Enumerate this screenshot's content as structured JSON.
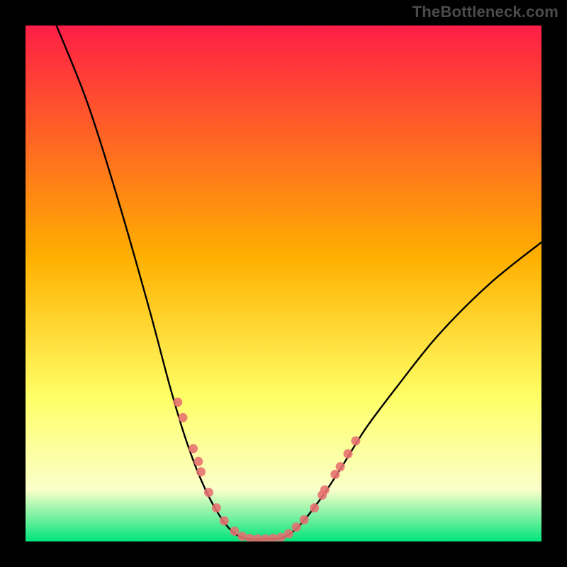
{
  "watermark": "TheBottleneck.com",
  "chart_data": {
    "type": "line",
    "title": "",
    "xlabel": "",
    "ylabel": "",
    "xlim": [
      0,
      100
    ],
    "ylim": [
      0,
      100
    ],
    "grid": false,
    "legend": false,
    "background_gradient": {
      "top": "#ff1e46",
      "mid1": "#ffb000",
      "mid2": "#ffff66",
      "mid3": "#faffca",
      "bottom": "#00e47a"
    },
    "curve": [
      {
        "x": 6,
        "y": 100
      },
      {
        "x": 12,
        "y": 85
      },
      {
        "x": 18,
        "y": 66
      },
      {
        "x": 24,
        "y": 45
      },
      {
        "x": 28,
        "y": 30
      },
      {
        "x": 31,
        "y": 20
      },
      {
        "x": 34,
        "y": 12
      },
      {
        "x": 37,
        "y": 6
      },
      {
        "x": 40,
        "y": 2
      },
      {
        "x": 43,
        "y": 0.5
      },
      {
        "x": 47,
        "y": 0.5
      },
      {
        "x": 50,
        "y": 0.8
      },
      {
        "x": 53,
        "y": 3
      },
      {
        "x": 57,
        "y": 8
      },
      {
        "x": 61,
        "y": 14
      },
      {
        "x": 66,
        "y": 22
      },
      {
        "x": 72,
        "y": 30
      },
      {
        "x": 80,
        "y": 40
      },
      {
        "x": 90,
        "y": 50
      },
      {
        "x": 100,
        "y": 58
      }
    ],
    "markers": [
      {
        "x": 29.5,
        "y": 27
      },
      {
        "x": 30.5,
        "y": 24
      },
      {
        "x": 32.5,
        "y": 18
      },
      {
        "x": 33.5,
        "y": 15.5
      },
      {
        "x": 34,
        "y": 13.5
      },
      {
        "x": 35.5,
        "y": 9.5
      },
      {
        "x": 37,
        "y": 6.5
      },
      {
        "x": 38.5,
        "y": 4
      },
      {
        "x": 40.5,
        "y": 2
      },
      {
        "x": 42,
        "y": 1
      },
      {
        "x": 43.5,
        "y": 0.6
      },
      {
        "x": 45,
        "y": 0.5
      },
      {
        "x": 46.5,
        "y": 0.5
      },
      {
        "x": 48,
        "y": 0.6
      },
      {
        "x": 49.5,
        "y": 0.8
      },
      {
        "x": 51,
        "y": 1.5
      },
      {
        "x": 52.5,
        "y": 2.8
      },
      {
        "x": 54,
        "y": 4.2
      },
      {
        "x": 56,
        "y": 6.5
      },
      {
        "x": 57.5,
        "y": 9
      },
      {
        "x": 58,
        "y": 10
      },
      {
        "x": 60,
        "y": 13
      },
      {
        "x": 61,
        "y": 14.5
      },
      {
        "x": 62.5,
        "y": 17
      },
      {
        "x": 64,
        "y": 19.5
      }
    ],
    "marker_color": "#e76f6f"
  }
}
